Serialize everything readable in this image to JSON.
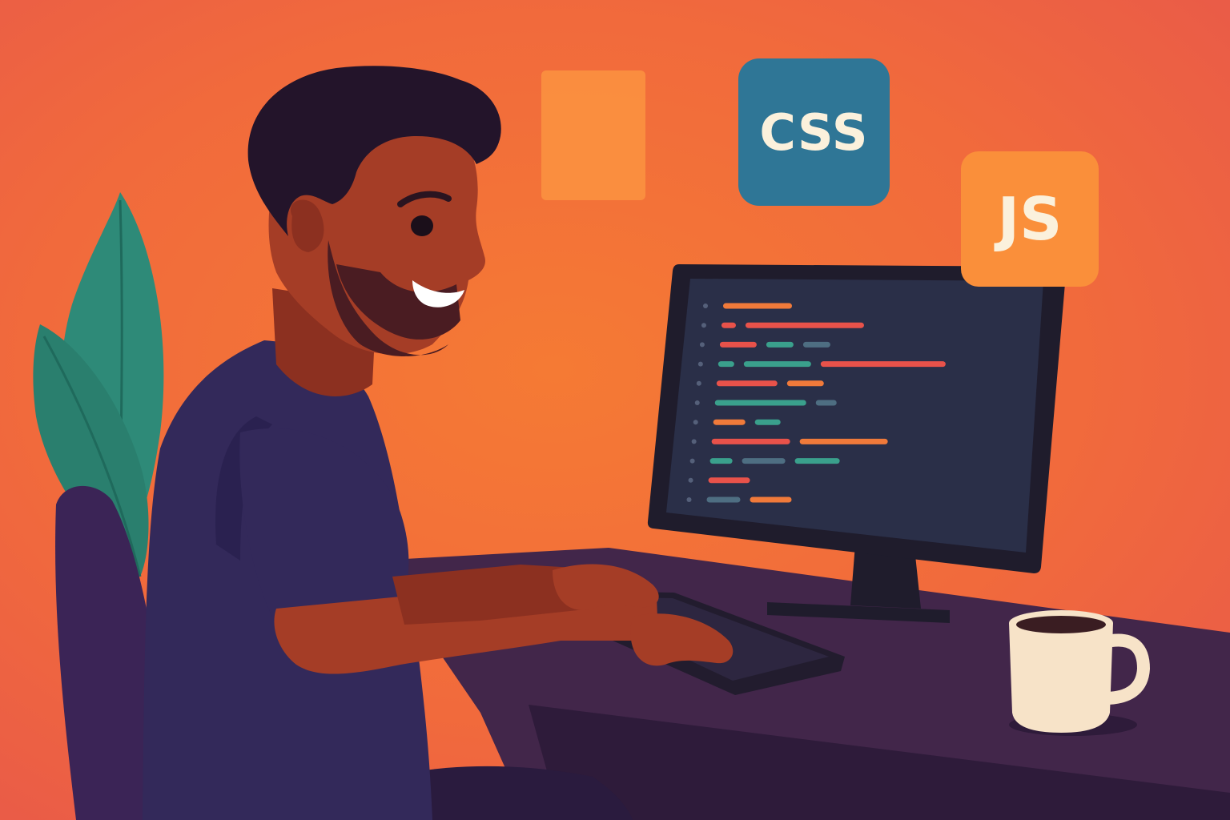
{
  "scene": {
    "colors": {
      "background_center": "#f57a34",
      "background_edge": "#e8584a",
      "sticky_note": "#fa8f3f",
      "skin": "#a53d26",
      "skin_shadow": "#8c3020",
      "hair": "#23142a",
      "shirt": "#33295a",
      "shirt_shadow": "#2a2150",
      "chair": "#3b2456",
      "desk_top": "#42264a",
      "desk_front": "#2e1b3a",
      "plant": "#2e8a78",
      "monitor_frame": "#1f1c2c",
      "screen": "#2a2f48",
      "code_orange": "#f07a3a",
      "code_red": "#e8524a",
      "code_teal": "#3aa08c",
      "code_gray": "#4e6e82",
      "mug": "#f7e3c8",
      "coffee": "#3a1d22"
    }
  },
  "badges": {
    "css": {
      "label": "CSS",
      "bg": "#2f7696",
      "fg": "#fbf1dc"
    },
    "js": {
      "label": "JS",
      "bg": "#fa8f3a",
      "fg": "#fbf1dc"
    }
  },
  "editor": {
    "lines": [
      [
        {
          "c": "orange",
          "w": 86
        }
      ],
      [
        {
          "c": "red",
          "w": 18
        },
        {
          "c": "red",
          "w": 148
        }
      ],
      [
        {
          "c": "red",
          "w": 46
        },
        {
          "c": "teal",
          "w": 34
        },
        {
          "c": "gray",
          "w": 34
        }
      ],
      [
        {
          "c": "teal",
          "w": 20
        },
        {
          "c": "teal",
          "w": 84
        },
        {
          "c": "red",
          "w": 156
        }
      ],
      [
        {
          "c": "red",
          "w": 76
        },
        {
          "c": "orange",
          "w": 46
        }
      ],
      [
        {
          "c": "teal",
          "w": 114
        },
        {
          "c": "gray",
          "w": 26
        }
      ],
      [
        {
          "c": "orange",
          "w": 40
        },
        {
          "c": "teal",
          "w": 32
        }
      ],
      [
        {
          "c": "red",
          "w": 98
        },
        {
          "c": "orange",
          "w": 110
        }
      ],
      [
        {
          "c": "teal",
          "w": 28
        },
        {
          "c": "gray",
          "w": 54
        },
        {
          "c": "teal",
          "w": 56
        }
      ],
      [
        {
          "c": "red",
          "w": 52
        }
      ],
      [
        {
          "c": "gray",
          "w": 42
        },
        {
          "c": "orange",
          "w": 52
        }
      ]
    ]
  }
}
